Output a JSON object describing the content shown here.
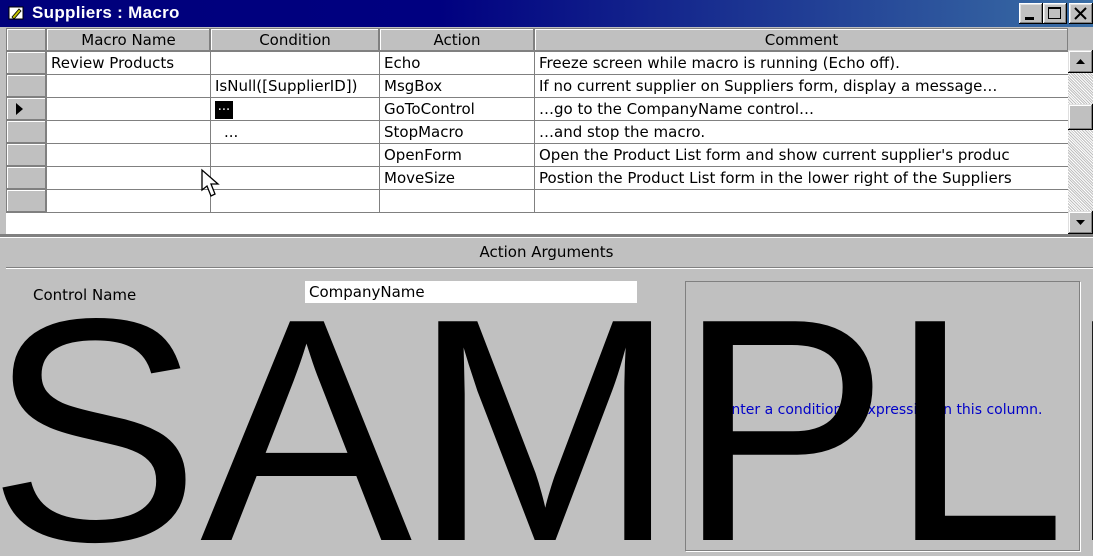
{
  "window": {
    "title": "Suppliers : Macro",
    "title_icon": "macro-icon"
  },
  "grid": {
    "columns": [
      "Macro Name",
      "Condition",
      "Action",
      "Comment"
    ],
    "rows": [
      {
        "macro_name": "Review Products",
        "condition": "",
        "action": "Echo",
        "comment": "Freeze screen while macro is running (Echo off)."
      },
      {
        "macro_name": "",
        "condition": "IsNull([SupplierID])",
        "action": "MsgBox",
        "comment": "If no current supplier on Suppliers form, display a message…"
      },
      {
        "macro_name": "",
        "condition": "...",
        "action": "GoToControl",
        "comment": "…go to the CompanyName control…"
      },
      {
        "macro_name": "",
        "condition": "...",
        "action": "StopMacro",
        "comment": "…and stop the macro."
      },
      {
        "macro_name": "",
        "condition": "",
        "action": "OpenForm",
        "comment": "Open the Product List form and show current supplier's produc"
      },
      {
        "macro_name": "",
        "condition": "",
        "action": "MoveSize",
        "comment": "Postion the Product List form in the lower right of the Suppliers"
      },
      {
        "macro_name": "",
        "condition": "",
        "action": "",
        "comment": ""
      }
    ],
    "current_row_indicator": "record-selector-arrow"
  },
  "args": {
    "header": "Action Arguments",
    "control_name_label": "Control Name",
    "control_name_value": "CompanyName",
    "help_text": "Enter a conditional expression in this column."
  },
  "watermark": {
    "text": "SAMPLE"
  },
  "colors": {
    "titlebar_start": "#000080",
    "titlebar_end": "#3a6ea5",
    "help_text": "#0000c8",
    "face": "#c0c0c0"
  }
}
